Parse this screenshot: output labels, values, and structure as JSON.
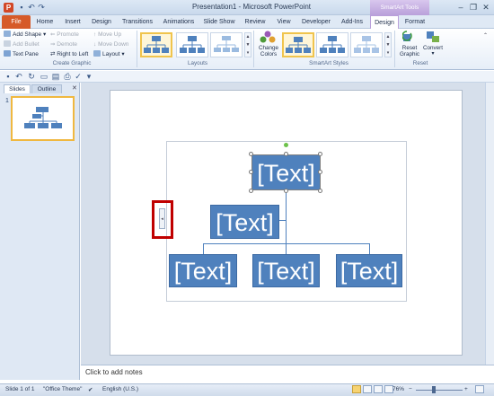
{
  "titlebar": {
    "app_icon_letter": "P",
    "title": "Presentation1 - Microsoft PowerPoint",
    "contextual_group": "SmartArt Tools",
    "minimize": "–",
    "restore": "❐",
    "close": "✕"
  },
  "tabs": {
    "file": "File",
    "home": "Home",
    "insert": "Insert",
    "design": "Design",
    "transitions": "Transitions",
    "animations": "Animations",
    "slideshow": "Slide Show",
    "review": "Review",
    "view": "View",
    "developer": "Developer",
    "addins": "Add-Ins",
    "smartart_design": "Design",
    "format": "Format"
  },
  "ribbon": {
    "create_graphic": {
      "add_shape": "Add Shape",
      "add_bullet": "Add Bullet",
      "text_pane": "Text Pane",
      "promote": "Promote",
      "demote": "Demote",
      "right_to_left": "Right to Left",
      "move_up": "Move Up",
      "move_down": "Move Down",
      "layout": "Layout",
      "label": "Create Graphic"
    },
    "layouts": {
      "label": "Layouts"
    },
    "smartart_styles": {
      "change_colors_line1": "Change",
      "change_colors_line2": "Colors",
      "label": "SmartArt Styles"
    },
    "reset": {
      "reset_graphic_line1": "Reset",
      "reset_graphic_line2": "Graphic",
      "convert": "Convert",
      "label": "Reset"
    }
  },
  "slides_panel": {
    "tab_slides": "Slides",
    "tab_outline": "Outline",
    "slide_number": "1"
  },
  "smartart": {
    "top_node": "[Text]",
    "assistant_node": "[Text]",
    "child_nodes": [
      "[Text]",
      "[Text]",
      "[Text]"
    ],
    "text_pane_arrow": "◂"
  },
  "notes": {
    "placeholder": "Click to add notes"
  },
  "statusbar": {
    "slide_info": "Slide 1 of 1",
    "theme": "\"Office Theme\"",
    "language": "English (U.S.)",
    "zoom": "76%",
    "zoom_minus": "−",
    "zoom_plus": "+"
  }
}
